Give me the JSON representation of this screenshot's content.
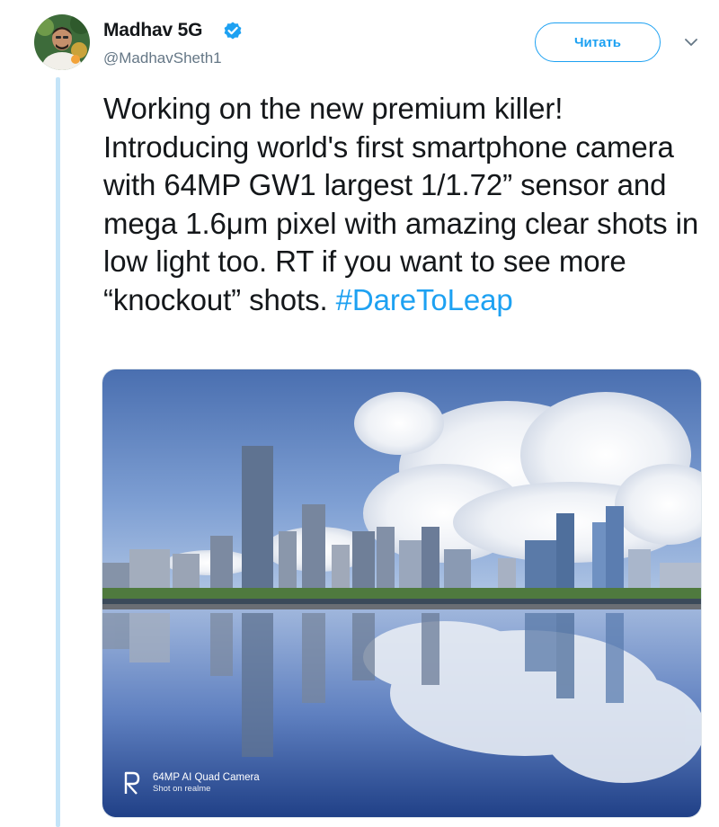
{
  "author": {
    "display_name": "Madhav 5G",
    "handle": "@MadhavSheth1",
    "verified": true,
    "verified_icon": "verified-badge-icon"
  },
  "follow_button": {
    "label": "Читать"
  },
  "menu": {
    "icon": "chevron-down-icon"
  },
  "tweet": {
    "text": "Working on the new premium killer! Introducing world's first smartphone camera with 64MP GW1 largest 1/1.72” sensor and mega 1.6μm pixel with amazing clear shots in low light too. RT if you want to see more “knockout” shots. ",
    "hashtag": "#DareToLeap"
  },
  "media": {
    "watermark_line1": "64MP AI Quad Camera",
    "watermark_line2": "Shot on realme"
  },
  "colors": {
    "accent": "#1da1f2",
    "thread_line": "#c4e4f8",
    "secondary_text": "#657786"
  }
}
